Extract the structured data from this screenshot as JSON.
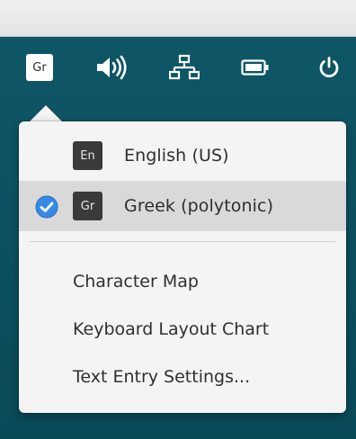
{
  "panel": {
    "indicators": [
      {
        "name": "keyboard-layout-indicator",
        "label": "Gr"
      },
      {
        "name": "volume-icon"
      },
      {
        "name": "network-icon"
      },
      {
        "name": "battery-icon"
      },
      {
        "name": "power-icon"
      }
    ]
  },
  "popover": {
    "sources": [
      {
        "badge": "En",
        "label": "English (US)",
        "selected": false
      },
      {
        "badge": "Gr",
        "label": "Greek (polytonic)",
        "selected": true
      }
    ],
    "actions": [
      {
        "label": "Character Map"
      },
      {
        "label": "Keyboard Layout Chart"
      },
      {
        "label": "Text Entry Settings..."
      }
    ]
  },
  "colors": {
    "desktop": "#0d5262",
    "popover_bg": "#f4f4f4",
    "selected_row": "#d9d9d9",
    "checkmark": "#3689e6"
  }
}
